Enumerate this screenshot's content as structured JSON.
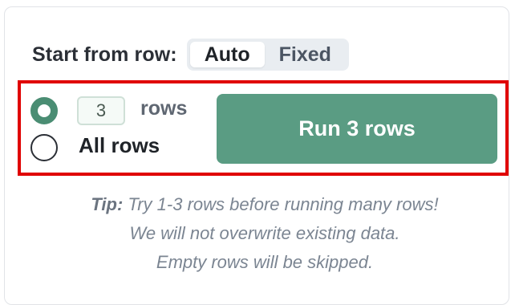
{
  "start_from": {
    "label": "Start from row:",
    "options": [
      {
        "label": "Auto",
        "selected": true
      },
      {
        "label": "Fixed",
        "selected": false
      }
    ]
  },
  "row_selection": {
    "count_value": "3",
    "count_unit": "rows",
    "all_rows_label": "All rows",
    "selected_option": "count"
  },
  "run_button": {
    "label": "Run 3 rows"
  },
  "tips": {
    "prefix": "Tip:",
    "line1": " Try 1-3 rows before running many rows!",
    "line2": "We will not overwrite existing data.",
    "line3": "Empty rows will be skipped."
  },
  "colors": {
    "accent_green": "#5a9c83",
    "highlight_red": "#e00000"
  }
}
